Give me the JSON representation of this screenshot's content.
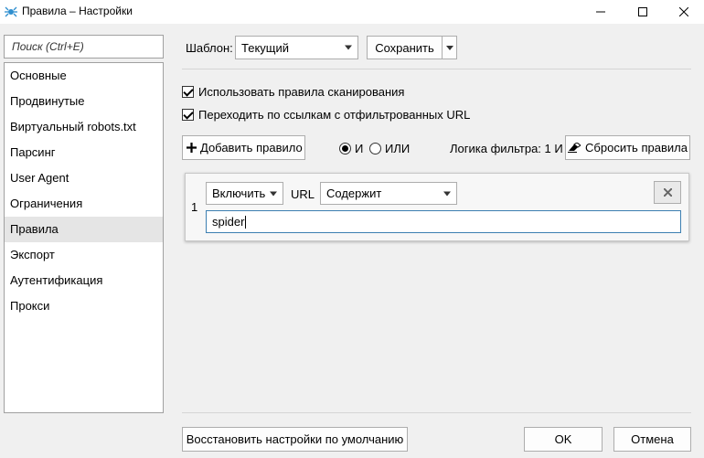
{
  "window": {
    "title": "Правила – Настройки",
    "icon": "spider-app-icon",
    "controls": {
      "minimize": "minimize-icon",
      "maximize": "maximize-icon",
      "close": "close-icon"
    }
  },
  "sidebar": {
    "search_placeholder": "Поиск (Ctrl+E)",
    "items": [
      {
        "label": "Основные"
      },
      {
        "label": "Продвинутые"
      },
      {
        "label": "Виртуальный robots.txt"
      },
      {
        "label": "Парсинг"
      },
      {
        "label": "User Agent"
      },
      {
        "label": "Ограничения"
      },
      {
        "label": "Правила",
        "active": true
      },
      {
        "label": "Экспорт"
      },
      {
        "label": "Аутентификация"
      },
      {
        "label": "Прокси"
      }
    ]
  },
  "template": {
    "label": "Шаблон:",
    "selected": "Текущий",
    "save_label": "Сохранить"
  },
  "options": {
    "use_scan_rules": {
      "label": "Использовать правила сканирования",
      "checked": true
    },
    "follow_filtered": {
      "label": "Переходить по ссылкам с отфильтрованных URL",
      "checked": true
    }
  },
  "rules_toolbar": {
    "add_label": "Добавить правило",
    "and_label": "И",
    "or_label": "ИЛИ",
    "logic_label": "Логика фильтра: 1 И",
    "reset_label": "Сбросить правила"
  },
  "rules": [
    {
      "index": "1",
      "action": "Включить",
      "field": "URL",
      "operator": "Содержит",
      "value": "spider"
    }
  ],
  "footer": {
    "restore_label": "Восстановить настройки по умолчанию",
    "ok_label": "OK",
    "cancel_label": "Отмена"
  }
}
